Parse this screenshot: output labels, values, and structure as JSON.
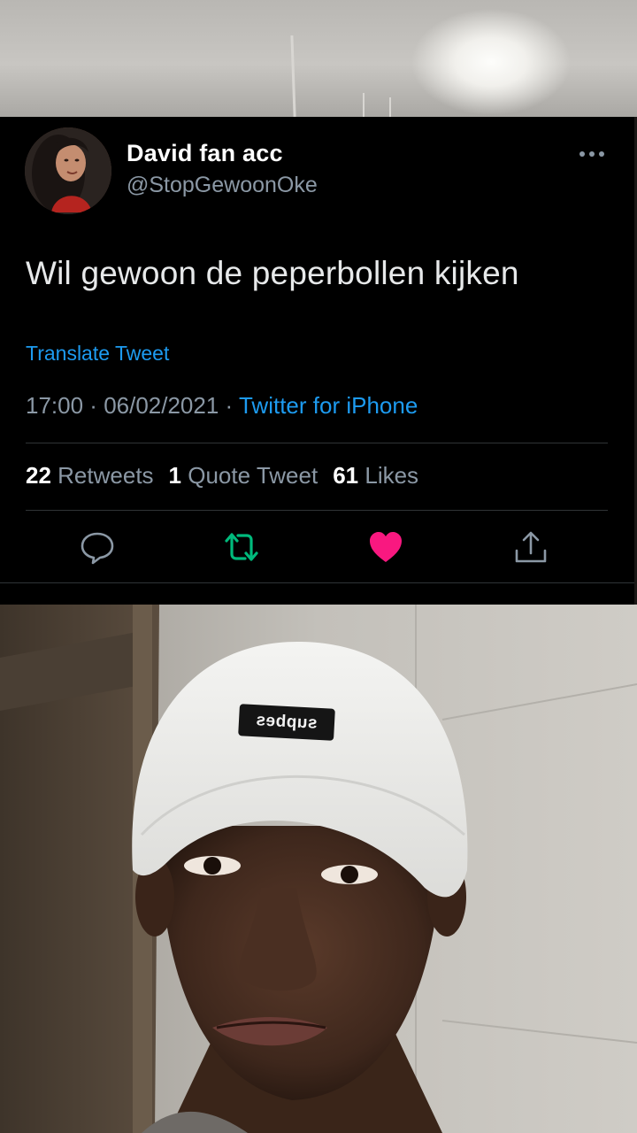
{
  "tweet": {
    "display_name": "David fan acc",
    "handle": "@StopGewoonOke",
    "text": "Wil gewoon de peperbollen kijken",
    "translate_label": "Translate Tweet",
    "time": "17:00",
    "separator": " · ",
    "date": "06/02/2021",
    "source": "Twitter for iPhone",
    "stats": {
      "retweets_count": "22",
      "retweets_label": "Retweets",
      "quotes_count": "1",
      "quotes_label": "Quote Tweet",
      "likes_count": "61",
      "likes_label": "Likes"
    },
    "icons": {
      "more": "more-horizontal-icon",
      "reply": "reply-bubble-icon",
      "retweet": "retweet-icon",
      "like": "heart-filled-icon",
      "share": "share-icon"
    },
    "colors": {
      "background": "#000000",
      "link": "#1d9bf0",
      "secondary_text": "#8b98a5",
      "retweet": "#00ba7c",
      "like": "#f91880"
    }
  },
  "photo": {
    "beanie_label": "supbes"
  }
}
